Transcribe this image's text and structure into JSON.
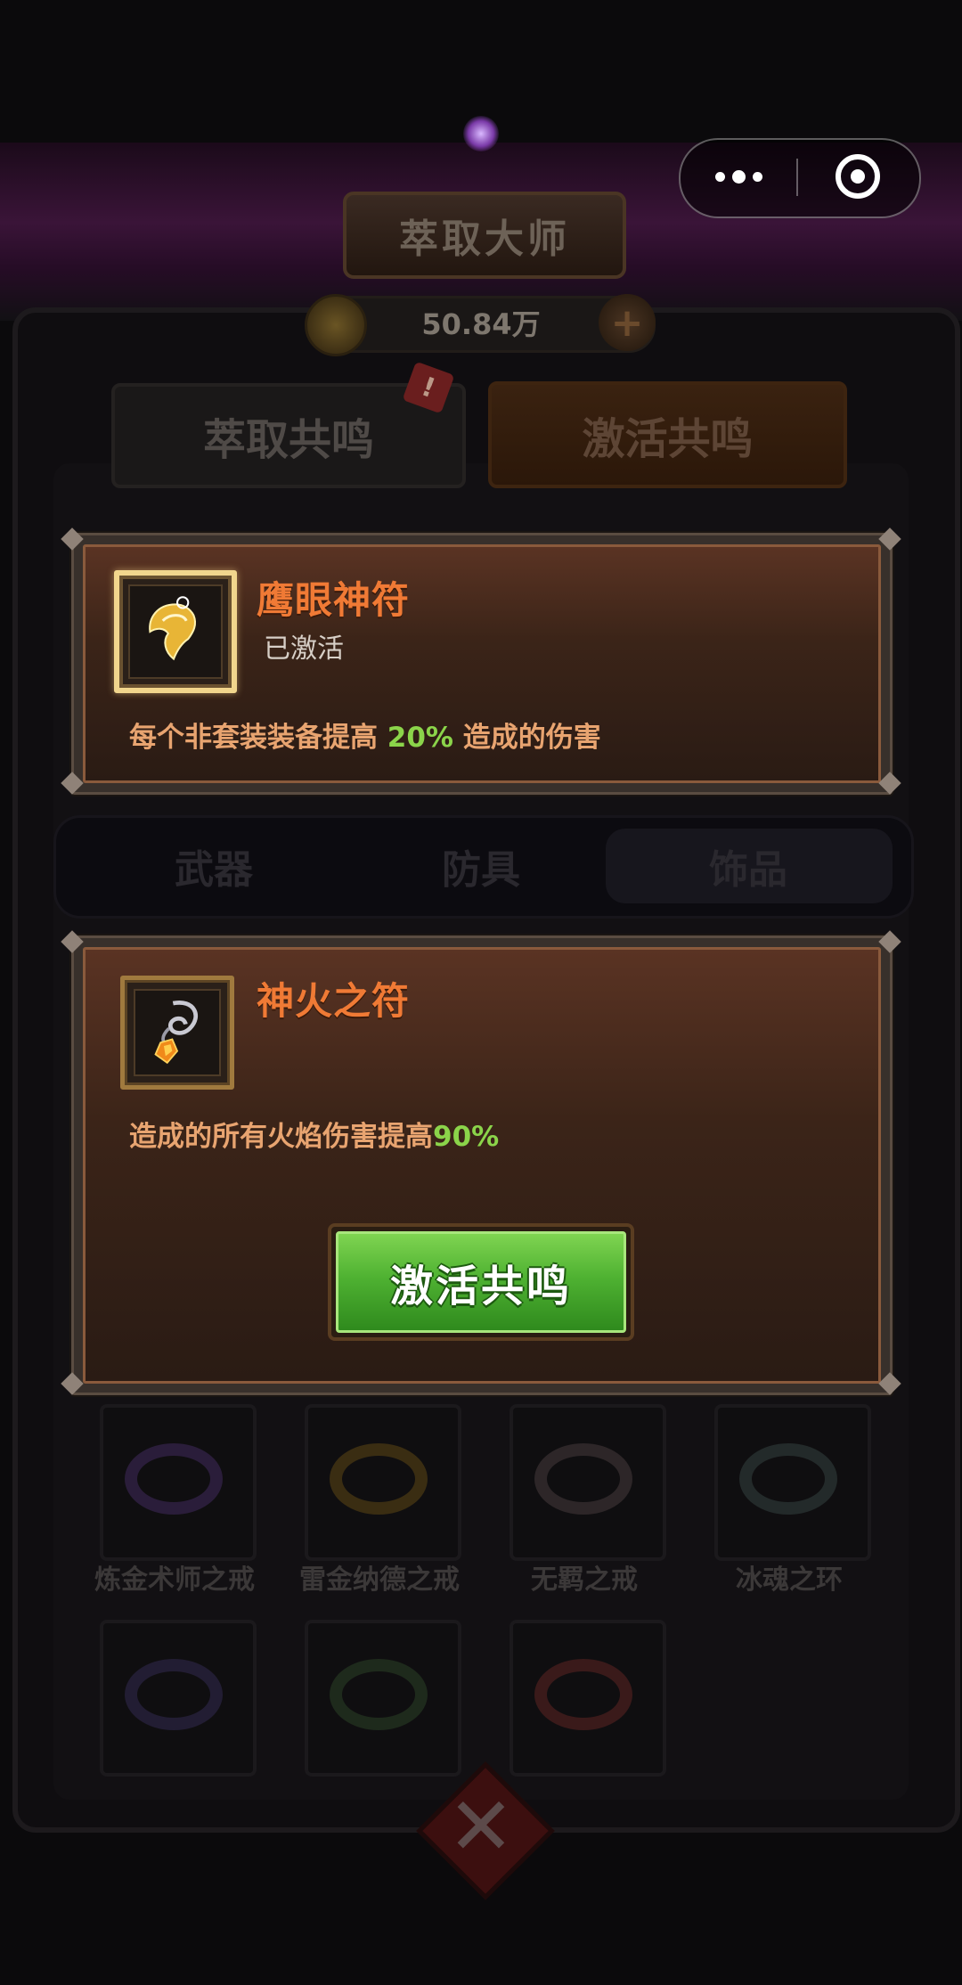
{
  "header": {
    "title": "萃取大师",
    "currency_amount": "50.84万"
  },
  "tabs": {
    "extract": "萃取共鸣",
    "activate": "激活共鸣",
    "badge": "!"
  },
  "capsule": {
    "more_icon": "more-dots-icon",
    "close_icon": "target-close-icon"
  },
  "active_resonance": {
    "name": "鹰眼神符",
    "status": "已激活",
    "desc_prefix": "每个非套装装备提高",
    "desc_value": "20%",
    "desc_suffix": "造成的伤害"
  },
  "categories": [
    {
      "label": "武器"
    },
    {
      "label": "防具"
    },
    {
      "label": "饰品",
      "selected": true
    }
  ],
  "selected_item": {
    "name": "神火之符",
    "desc_prefix": "造成的所有火焰伤害提高",
    "desc_value": "90%",
    "button_label": "激活共鸣"
  },
  "items": [
    {
      "name": "炼金术师之戒"
    },
    {
      "name": "雷金纳德之戒"
    },
    {
      "name": "无羁之戒"
    },
    {
      "name": "冰魂之环"
    }
  ],
  "colors": {
    "accent_orange": "#f07a35",
    "percent_green": "#8bd44a",
    "button_green": "#4fb232"
  }
}
